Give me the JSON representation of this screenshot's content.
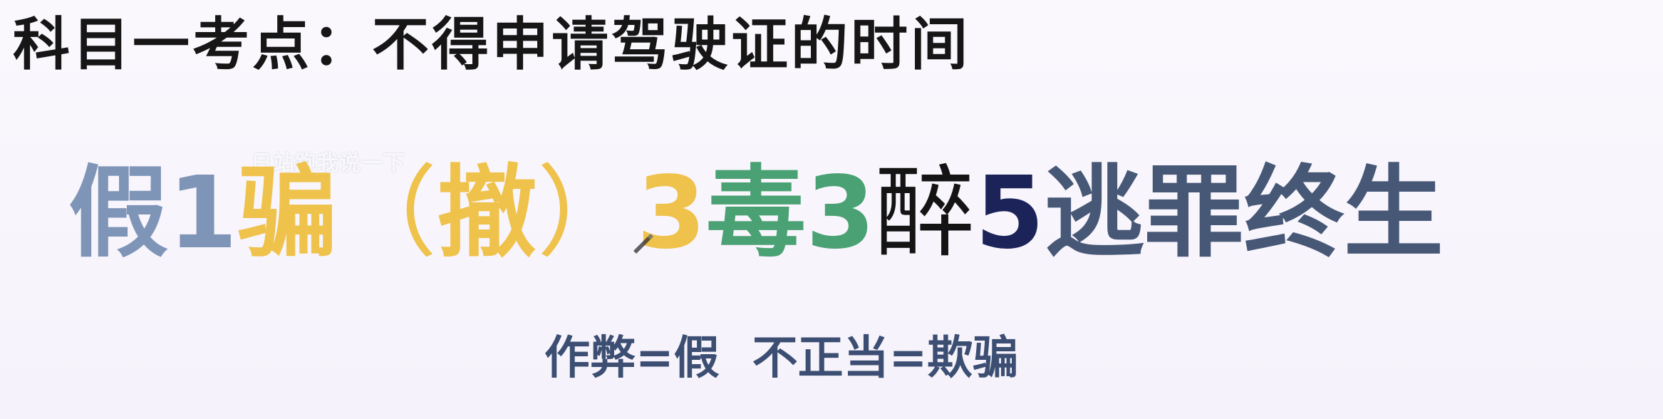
{
  "title": "科目一考点：不得申请驾驶证的时间",
  "watermark": "日站跑我说一下",
  "mnemonic": {
    "part1": "假",
    "part2": "1",
    "part3": "骗",
    "paren_open": "（",
    "part4": "撤",
    "paren_close": "）",
    "part5": "3",
    "part6": "毒",
    "part7": "3",
    "part8": "醉",
    "part9": "5",
    "part10": "逃罪终生"
  },
  "note": {
    "left": "作弊=假",
    "right": "不正当=欺骗"
  },
  "colors": {
    "blue_grey": "#7f95b7",
    "yellow": "#efc24b",
    "green": "#4aa173",
    "navy": "#1b2358",
    "slate": "#475877"
  }
}
